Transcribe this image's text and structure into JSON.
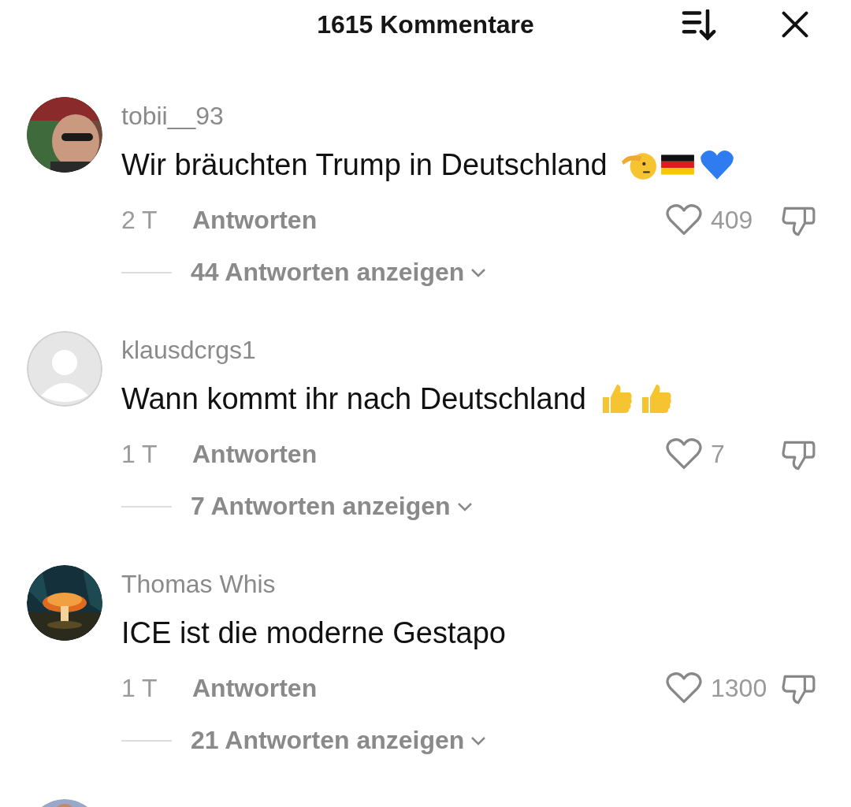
{
  "header": {
    "title": "1615 Kommentare"
  },
  "comments": [
    {
      "username": "tobii__93",
      "text": "Wir bräuchten Trump in Deutschland",
      "emojis": [
        {
          "kind": "saluting_face"
        },
        {
          "kind": "german_flag"
        },
        {
          "kind": "blue_heart"
        }
      ],
      "age": "2 T",
      "reply_label": "Antworten",
      "likes": "409",
      "liked": false,
      "view_replies": "44 Antworten anzeigen"
    },
    {
      "avatar": {
        "kind": "default"
      },
      "username": "klausdcrgs1",
      "text": "Wann kommt ihr nach Deutschland",
      "emojis": [
        {
          "kind": "thumbs_up"
        },
        {
          "kind": "thumbs_up"
        }
      ],
      "age": "1 T",
      "reply_label": "Antworten",
      "likes": "7",
      "liked": false,
      "view_replies": "7 Antworten anzeigen"
    },
    {
      "avatar": {
        "kind": "photo_mushroom"
      },
      "username": "Thomas Whis",
      "text": "ICE ist die moderne Gestapo",
      "age": "1 T",
      "reply_label": "Antworten",
      "likes": "1300",
      "liked": false,
      "view_replies": "21 Antworten anzeigen"
    }
  ]
}
